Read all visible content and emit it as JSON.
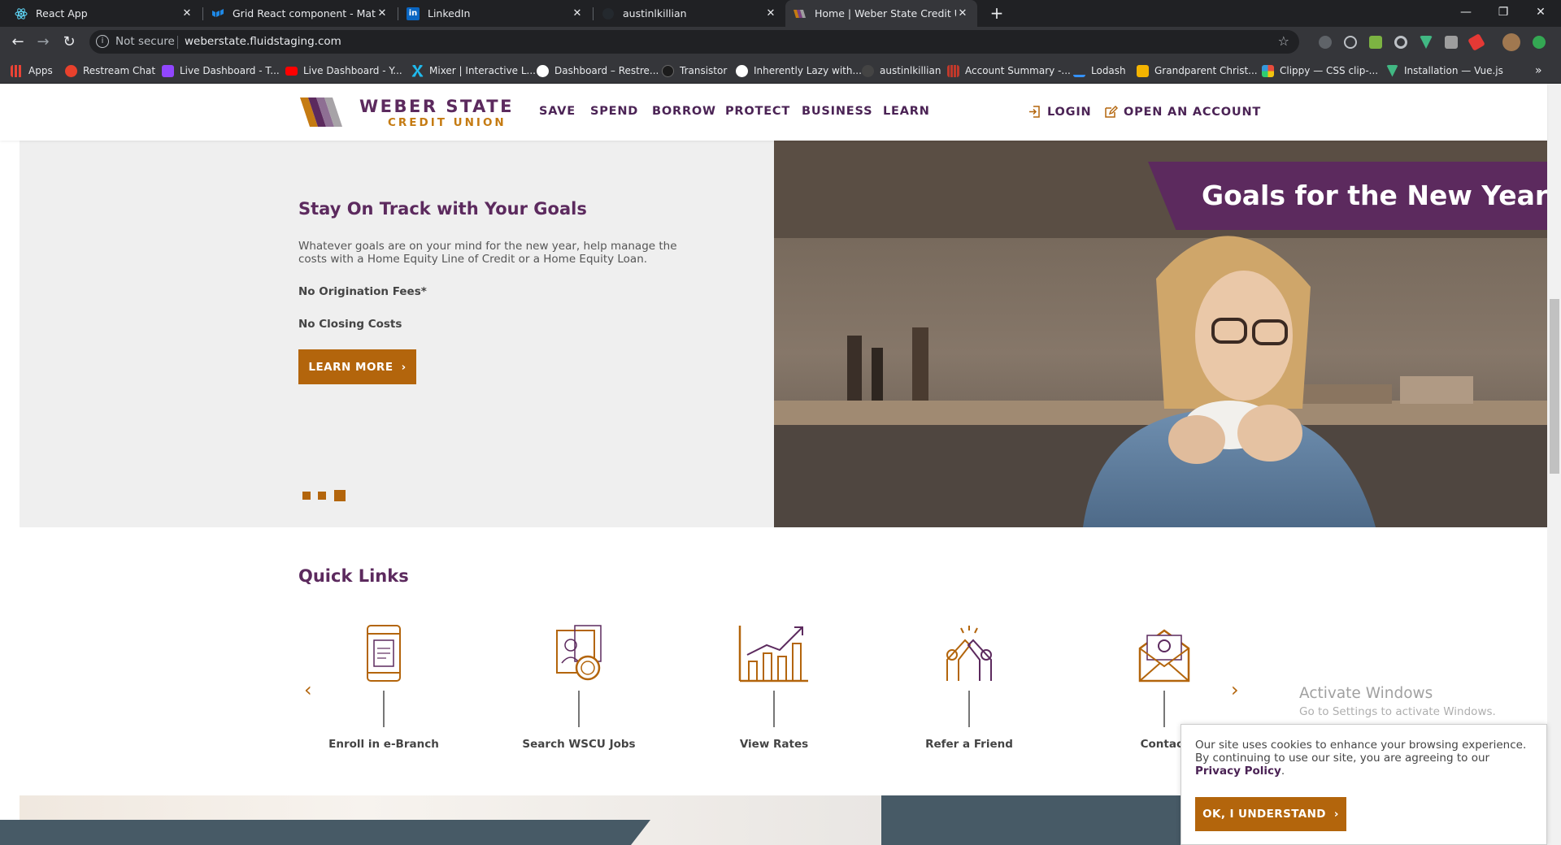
{
  "browser": {
    "tabs": [
      {
        "title": "React App",
        "active": false
      },
      {
        "title": "Grid React component - Material",
        "active": false
      },
      {
        "title": "LinkedIn",
        "active": false
      },
      {
        "title": "austinlkillian",
        "active": false
      },
      {
        "title": "Home | Weber State Credit Union",
        "active": true
      }
    ],
    "address": {
      "security": "Not secure",
      "url": "weberstate.fluidstaging.com"
    },
    "bookmarks": [
      {
        "label": "Apps",
        "icon": "apps-grid-icon",
        "color": "#ea4335"
      },
      {
        "label": "Restream Chat",
        "icon": "restream-icon",
        "color": "#e8412c"
      },
      {
        "label": "Live Dashboard - T...",
        "icon": "twitch-icon",
        "color": "#9146ff"
      },
      {
        "label": "Live Dashboard - Y...",
        "icon": "youtube-icon",
        "color": "#ff0000"
      },
      {
        "label": "Mixer | Interactive L...",
        "icon": "mixer-icon",
        "color": "#1fbaed"
      },
      {
        "label": "Dashboard – Restre...",
        "icon": "restream-r-icon",
        "color": "#ffffff"
      },
      {
        "label": "Transistor",
        "icon": "transistor-icon",
        "color": "#333333"
      },
      {
        "label": "Inherently Lazy with...",
        "icon": "globe-icon",
        "color": "#ffffff"
      },
      {
        "label": "austinlkillian",
        "icon": "github-icon",
        "color": "#444444"
      },
      {
        "label": "Account Summary -...",
        "icon": "bank-icon",
        "color": "#c0392b"
      },
      {
        "label": "Lodash",
        "icon": "lodash-icon",
        "color": "#3492ff"
      },
      {
        "label": "Grandparent Christ...",
        "icon": "bookmark-icon",
        "color": "#f4b400"
      },
      {
        "label": "Clippy — CSS clip-...",
        "icon": "clippy-icon",
        "color": "#e67e22"
      },
      {
        "label": "Installation — Vue.js",
        "icon": "vue-icon",
        "color": "#41b883"
      }
    ]
  },
  "site": {
    "logo": {
      "line1": "WEBER STATE",
      "line2": "CREDIT UNION"
    },
    "nav": [
      "SAVE",
      "SPEND",
      "BORROW",
      "PROTECT",
      "BUSINESS",
      "LEARN"
    ],
    "login": "LOGIN",
    "open_account": "OPEN AN ACCOUNT",
    "hero": {
      "title": "Stay On Track with Your Goals",
      "description": "Whatever goals are on your mind for the new year, help manage the costs with a Home Equity Line of Credit or a Home Equity Loan.",
      "feature1": "No Origination Fees*",
      "feature2": "No Closing Costs",
      "button": "LEARN MORE",
      "ribbon": "Goals for the New Year",
      "slides_total": 3,
      "slide_active": 3
    },
    "quick_links": {
      "title": "Quick Links",
      "items": [
        {
          "label": "Enroll in e-Branch",
          "icon": "mobile-phone-icon"
        },
        {
          "label": "Search WSCU Jobs",
          "icon": "job-search-icon"
        },
        {
          "label": "View Rates",
          "icon": "rates-chart-icon"
        },
        {
          "label": "Refer a Friend",
          "icon": "high-five-icon"
        },
        {
          "label": "Contact",
          "icon": "email-envelope-icon"
        }
      ]
    },
    "cookie": {
      "text": "Our site uses cookies to enhance your browsing experience. By continuing to use our site, you are agreeing to our ",
      "link": "Privacy Policy",
      "period": ".",
      "button": "OK, I UNDERSTAND"
    }
  },
  "os_watermark": {
    "line1": "Activate Windows",
    "line2": "Go to Settings to activate Windows."
  },
  "colors": {
    "purple": "#5c2a5e",
    "gold": "#b3650c",
    "slate": "#475a66"
  }
}
